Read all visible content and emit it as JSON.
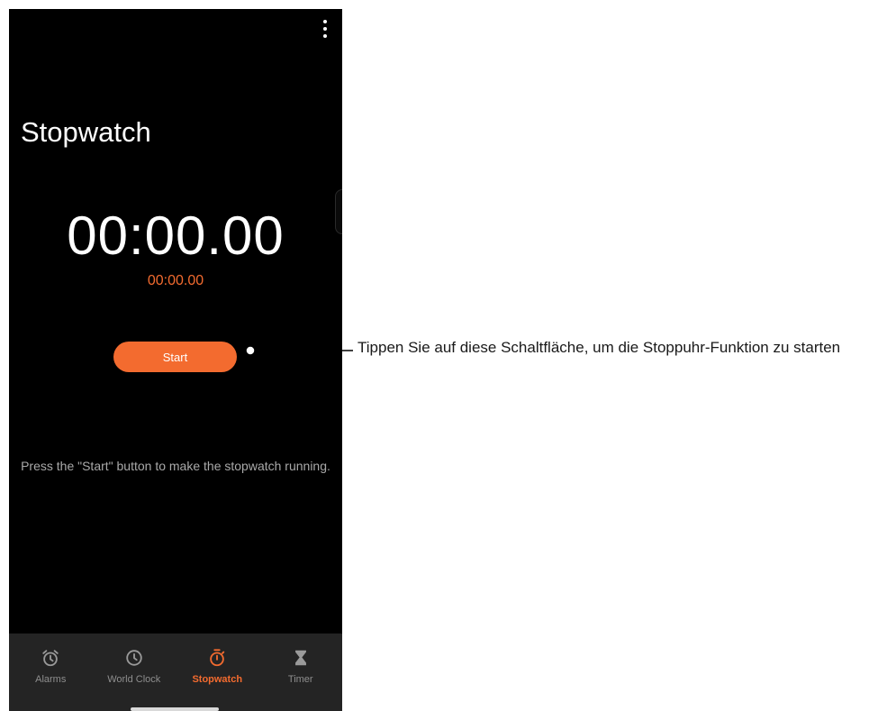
{
  "screen": {
    "title": "Stopwatch",
    "menu_icon": "more-vert-icon",
    "main_time": "00:00.00",
    "lap_time": "00:00.00",
    "start_label": "Start",
    "hint": "Press the \"Start\" button to make the stopwatch running."
  },
  "nav": {
    "items": [
      {
        "label": "Alarms",
        "icon": "alarm-icon",
        "active": false
      },
      {
        "label": "World Clock",
        "icon": "clock-icon",
        "active": false
      },
      {
        "label": "Stopwatch",
        "icon": "stopwatch-icon",
        "active": true
      },
      {
        "label": "Timer",
        "icon": "hourglass-icon",
        "active": false
      }
    ]
  },
  "annotation": {
    "text": "Tippen Sie auf diese Schaltfläche, um die Stoppuhr-Funktion zu starten"
  },
  "colors": {
    "accent": "#f36b2f",
    "background": "#000000",
    "nav_background": "#242424",
    "hint_text": "#a9a9a9"
  }
}
